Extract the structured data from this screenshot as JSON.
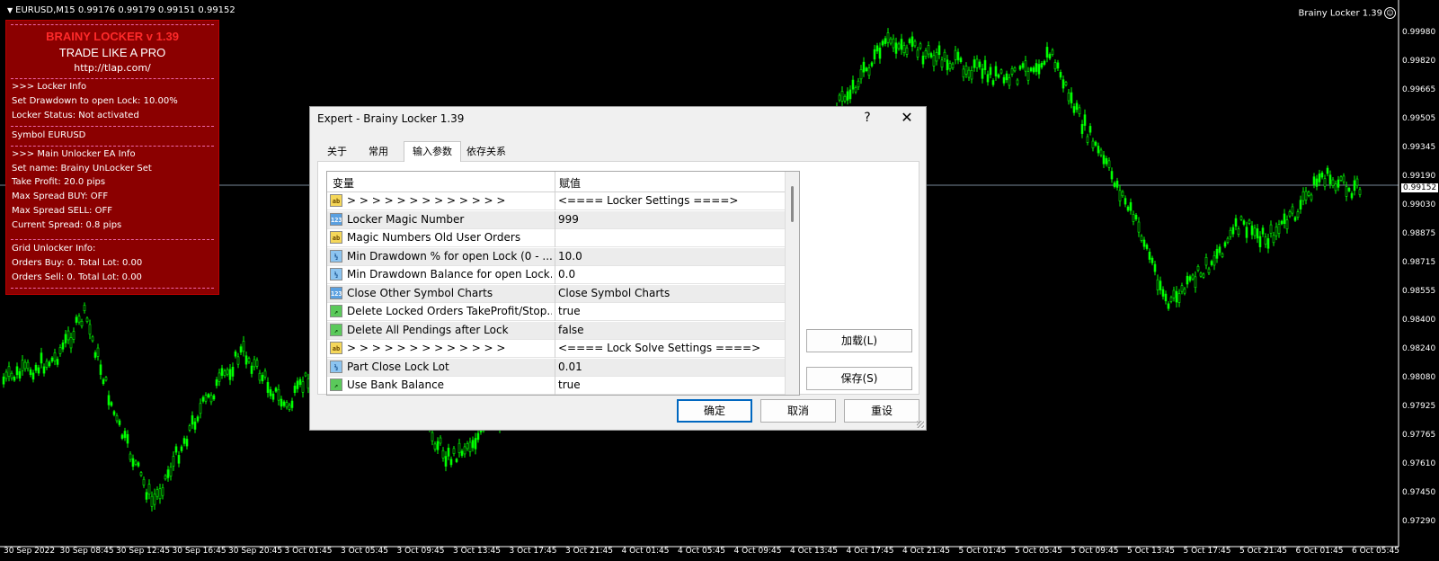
{
  "chart": {
    "symbol_line": "EURUSD,M15  0.99176 0.99179 0.99151 0.99152",
    "ea_label": "Brainy Locker 1.39",
    "bull_color": "#00ff00",
    "price_labels": [
      "0.99980",
      "0.99820",
      "0.99665",
      "0.99505",
      "0.99345",
      "0.99190",
      "0.99030",
      "0.98875",
      "0.98715",
      "0.98555",
      "0.98400",
      "0.98240",
      "0.98080",
      "0.97925",
      "0.97765",
      "0.97610",
      "0.97450",
      "0.97290"
    ],
    "current_price": "0.99152",
    "time_labels": [
      "30 Sep 2022",
      "30 Sep 08:45",
      "30 Sep 12:45",
      "30 Sep 16:45",
      "30 Sep 20:45",
      "3 Oct 01:45",
      "3 Oct 05:45",
      "3 Oct 09:45",
      "3 Oct 13:45",
      "3 Oct 17:45",
      "3 Oct 21:45",
      "4 Oct 01:45",
      "4 Oct 05:45",
      "4 Oct 09:45",
      "4 Oct 13:45",
      "4 Oct 17:45",
      "4 Oct 21:45",
      "5 Oct 01:45",
      "5 Oct 05:45",
      "5 Oct 09:45",
      "5 Oct 13:45",
      "5 Oct 17:45",
      "5 Oct 21:45",
      "6 Oct 01:45",
      "6 Oct 05:45"
    ]
  },
  "info": {
    "title": "BRAINY LOCKER v 1.39",
    "slogan": "TRADE LIKE A PRO",
    "url": "http://tlap.com/",
    "locker_header": ">>> Locker Info",
    "drawdown": "Set Drawdown to open Lock: 10.00%",
    "status": "Locker Status: Not activated",
    "symbol": "Symbol EURUSD",
    "unlocker_header": ">>> Main Unlocker EA Info",
    "set_name": "Set name: Brainy UnLocker Set",
    "take_profit": "Take Profit: 20.0 pips",
    "spread_buy": "Max Spread BUY: OFF",
    "spread_sell": "Max Spread SELL: OFF",
    "current_spread": "Current Spread: 0.8 pips",
    "grid_header": "Grid Unlocker Info:",
    "orders_buy": "Orders Buy: 0. Total Lot: 0.00",
    "orders_sell": "Orders Sell: 0. Total Lot: 0.00"
  },
  "dialog": {
    "title": "Expert - Brainy Locker 1.39",
    "help": "?",
    "close": "✕",
    "tabs": [
      "关于",
      "常用",
      "输入参数",
      "依存关系"
    ],
    "grid_header": {
      "variable": "变量",
      "value": "赋值"
    },
    "rows": [
      {
        "icon": "ab",
        "name": ">  >  >  >  >  >  >  >  >  >  >  >  >",
        "value": "<==== Locker Settings ====>"
      },
      {
        "icon": "123",
        "name": "Locker Magic Number",
        "value": "999"
      },
      {
        "icon": "ab",
        "name": "Magic Numbers Old User Orders",
        "value": ""
      },
      {
        "icon": "v2",
        "name": "Min Drawdown % for open Lock (0 - ...",
        "value": "10.0"
      },
      {
        "icon": "v2",
        "name": "Min Drawdown Balance for open Lock...",
        "value": "0.0"
      },
      {
        "icon": "123",
        "name": "Close Other Symbol Charts",
        "value": "Close Symbol Charts"
      },
      {
        "icon": "flag",
        "name": "Delete Locked Orders TakeProfit/Stop...",
        "value": "true"
      },
      {
        "icon": "flag",
        "name": "Delete All Pendings after Lock",
        "value": "false"
      },
      {
        "icon": "ab",
        "name": ">  >  >  >  >  >  >  >  >  >  >  >  >",
        "value": "<==== Lock Solve Settings ====>"
      },
      {
        "icon": "v2",
        "name": "Part Close Lock Lot",
        "value": "0.01"
      },
      {
        "icon": "flag",
        "name": "Use Bank Balance",
        "value": "true"
      }
    ],
    "load_button": "加载(L)",
    "save_button": "保存(S)",
    "ok_button": "确定",
    "cancel_button": "取消",
    "reset_button": "重设"
  }
}
